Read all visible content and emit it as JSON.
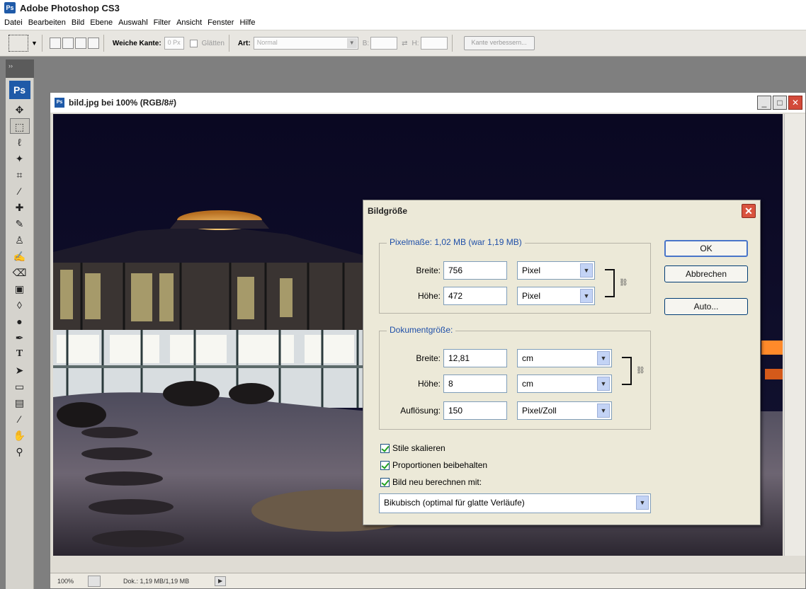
{
  "app": {
    "title": "Adobe Photoshop CS3",
    "icon_text": "Ps"
  },
  "menu": [
    "Datei",
    "Bearbeiten",
    "Bild",
    "Ebene",
    "Auswahl",
    "Filter",
    "Ansicht",
    "Fenster",
    "Hilfe"
  ],
  "options": {
    "feather_label": "Weiche Kante:",
    "feather_value": "0 Px",
    "antialias_label": "Glätten",
    "style_label": "Art:",
    "style_value": "Normal",
    "width_label": "B:",
    "height_label": "H:",
    "refine_button": "Kante verbessern..."
  },
  "toolbox": {
    "logo": "Ps",
    "grip": "››"
  },
  "document": {
    "title": "bild.jpg bei 100% (RGB/8#)",
    "status_zoom": "100%",
    "status_doc": "Dok.: 1,19 MB/1,19 MB"
  },
  "dialog": {
    "title": "Bildgröße",
    "pixel_group": "Pixelmaße: 1,02 MB (war 1,19 MB)",
    "pixel_width_label": "Breite:",
    "pixel_width_value": "756",
    "pixel_width_unit": "Pixel",
    "pixel_height_label": "Höhe:",
    "pixel_height_value": "472",
    "pixel_height_unit": "Pixel",
    "doc_group": "Dokumentgröße:",
    "doc_width_label": "Breite:",
    "doc_width_value": "12,81",
    "doc_width_unit": "cm",
    "doc_height_label": "Höhe:",
    "doc_height_value": "8",
    "doc_height_unit": "cm",
    "resolution_label": "Auflösung:",
    "resolution_value": "150",
    "resolution_unit": "Pixel/Zoll",
    "scale_styles": "Stile skalieren",
    "constrain": "Proportionen beibehalten",
    "resample": "Bild neu berechnen mit:",
    "method": "Bikubisch (optimal für glatte Verläufe)",
    "ok": "OK",
    "cancel": "Abbrechen",
    "auto": "Auto..."
  }
}
